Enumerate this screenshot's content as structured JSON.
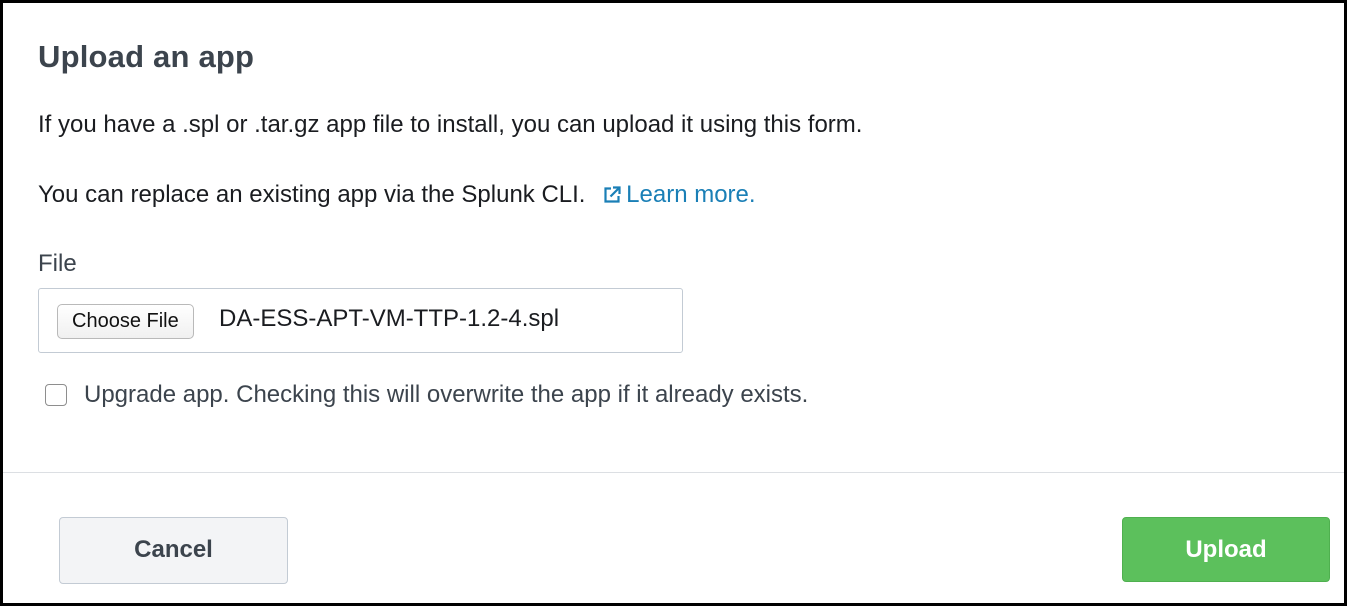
{
  "dialog": {
    "title": "Upload an app",
    "description": "If you have a .spl or .tar.gz app file to install, you can upload it using this form.",
    "replace_text": "You can replace an existing app via the Splunk CLI.",
    "learn_more_label": "Learn more.",
    "learn_more_icon": "external-link-icon"
  },
  "file_field": {
    "label": "File",
    "choose_button_label": "Choose File",
    "selected_file": "DA-ESS-APT-VM-TTP-1.2-4.spl"
  },
  "upgrade": {
    "checked": false,
    "label": "Upgrade app. Checking this will overwrite the app if it already exists."
  },
  "footer": {
    "cancel_label": "Cancel",
    "upload_label": "Upload"
  },
  "colors": {
    "link": "#1a7fb6",
    "primary_button": "#5cc05c",
    "title_text": "#3c444d"
  }
}
